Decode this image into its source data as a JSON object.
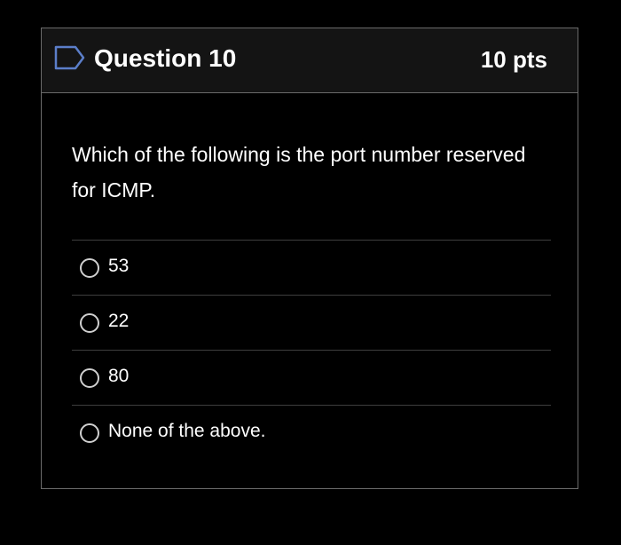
{
  "question": {
    "title": "Question 10",
    "points": "10 pts",
    "text": "Which of the following is the port number reserved for ICMP.",
    "flag_icon": "flag-outline-icon"
  },
  "answers": [
    {
      "label": "53",
      "selected": false
    },
    {
      "label": "22",
      "selected": false
    },
    {
      "label": "80",
      "selected": false
    },
    {
      "label": "None of the above.",
      "selected": false
    }
  ],
  "colors": {
    "background": "#000000",
    "header_background": "#141414",
    "border": "#6b6b6b",
    "flag_outline": "#5b7ec9",
    "text": "#ffffff"
  }
}
